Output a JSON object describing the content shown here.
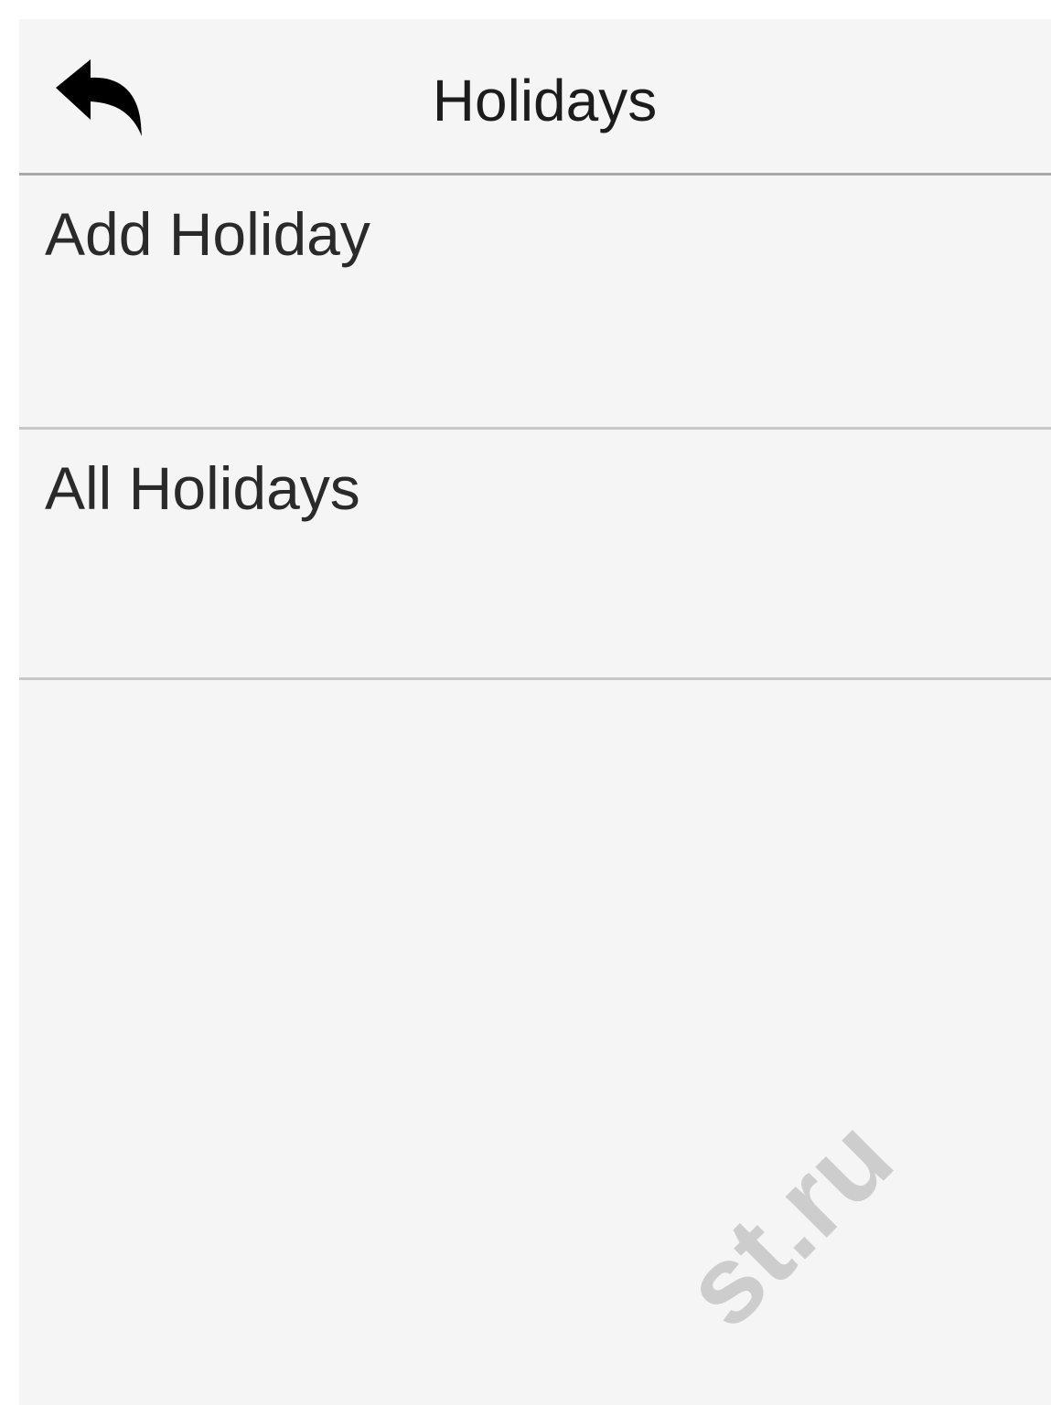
{
  "header": {
    "title": "Holidays",
    "back_icon": "back-arrow-icon"
  },
  "menu": {
    "items": [
      {
        "label": "Add Holiday"
      },
      {
        "label": "All Holidays"
      }
    ]
  },
  "watermark": {
    "text": "st.ru"
  },
  "colors": {
    "background": "#f5f5f5",
    "text": "#2a2a2a",
    "divider": "#c8c8c8",
    "header_divider": "#a9a9a9",
    "icon": "#000000"
  }
}
